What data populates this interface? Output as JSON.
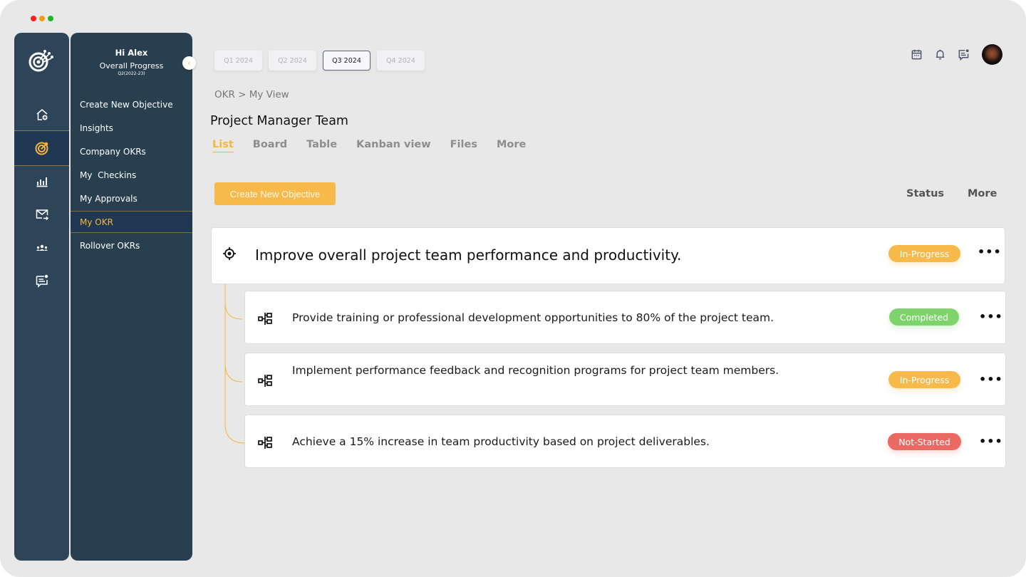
{
  "window": {
    "controls": [
      "close",
      "minimize",
      "maximize"
    ]
  },
  "rail": {
    "logo": "target-network-logo",
    "items": [
      {
        "icon": "home-plus-icon",
        "active": false
      },
      {
        "icon": "target-icon",
        "active": true
      },
      {
        "icon": "bar-chart-icon",
        "active": false
      },
      {
        "icon": "mail-forward-icon",
        "active": false
      },
      {
        "icon": "team-icon",
        "active": false
      },
      {
        "icon": "chat-notification-icon",
        "active": false
      }
    ]
  },
  "submenu": {
    "greeting": "Hi Alex",
    "progress_label": "Overall Progress",
    "period": "Q2(2022-23)",
    "items": [
      {
        "label": "Create New Objective",
        "active": false
      },
      {
        "label": "Insights",
        "active": false
      },
      {
        "label": "Company OKRs",
        "active": false
      },
      {
        "label": "My  Checkins",
        "active": false
      },
      {
        "label": "My Approvals",
        "active": false
      },
      {
        "label": "My OKR",
        "active": true
      },
      {
        "label": "Rollover OKRs",
        "active": false
      }
    ],
    "collapse_icon": "chevron-left-icon"
  },
  "quarters": [
    {
      "label": "Q1 2024",
      "active": false
    },
    {
      "label": "Q2 2024",
      "active": false
    },
    {
      "label": "Q3 2024",
      "active": true
    },
    {
      "label": "Q4 2024",
      "active": false
    }
  ],
  "topbar": {
    "icons": [
      "calendar-icon",
      "bell-icon",
      "chat-notification-icon"
    ],
    "avatar": "user-avatar"
  },
  "breadcrumb": "OKR > My View",
  "page_title": "Project Manager Team",
  "view_tabs": [
    {
      "label": "List",
      "active": true
    },
    {
      "label": "Board",
      "active": false
    },
    {
      "label": "Table",
      "active": false
    },
    {
      "label": "Kanban view",
      "active": false
    },
    {
      "label": "Files",
      "active": false
    },
    {
      "label": "More",
      "active": false
    }
  ],
  "actions": {
    "create_label": "Create New Objective",
    "status_label": "Status",
    "more_label": "More"
  },
  "colors": {
    "accent": "#f5b63f",
    "in_progress": "#f8b94b",
    "completed": "#7dd46a",
    "not_started": "#ea6a63",
    "sidebar": "#283f4f",
    "rail": "#2e4559"
  },
  "objective": {
    "title": "Improve overall project team performance and productivity.",
    "status": "In-Progress",
    "menu": "•••"
  },
  "key_results": [
    {
      "title": "Provide training or professional development opportunities to 80% of the project team.",
      "status": "Completed",
      "menu": "•••"
    },
    {
      "title": "Implement performance feedback and recognition programs for project team members.",
      "status": "In-Progress",
      "menu": "•••"
    },
    {
      "title": "Achieve a 15% increase in team productivity based on project deliverables.",
      "status": "Not-Started",
      "menu": "•••"
    }
  ]
}
